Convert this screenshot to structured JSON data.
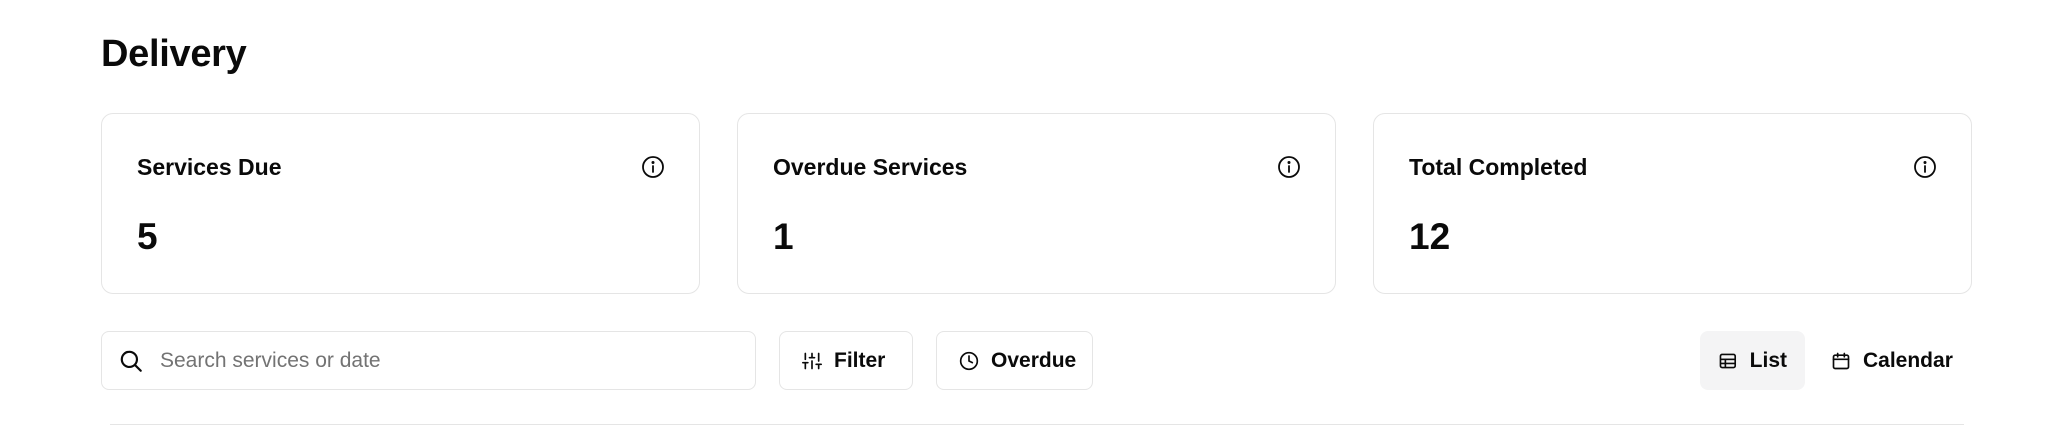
{
  "page": {
    "title": "Delivery"
  },
  "stats": [
    {
      "label": "Services Due",
      "value": "5",
      "icon": "info-icon"
    },
    {
      "label": "Overdue Services",
      "value": "1",
      "icon": "info-icon"
    },
    {
      "label": "Total Completed",
      "value": "12",
      "icon": "info-icon"
    }
  ],
  "toolbar": {
    "search": {
      "placeholder": "Search services or date",
      "value": "",
      "icon": "search-icon"
    },
    "filter_label": "Filter",
    "filter_icon": "sliders-icon",
    "overdue_label": "Overdue",
    "overdue_icon": "clock-icon",
    "views": [
      {
        "label": "List",
        "icon": "table-icon",
        "active": true
      },
      {
        "label": "Calendar",
        "icon": "calendar-icon",
        "active": false
      }
    ]
  },
  "colors": {
    "border": "#e5e5e5",
    "text": "#0a0a0a",
    "placeholder": "#737373",
    "active_view_bg": "#f4f4f5"
  }
}
